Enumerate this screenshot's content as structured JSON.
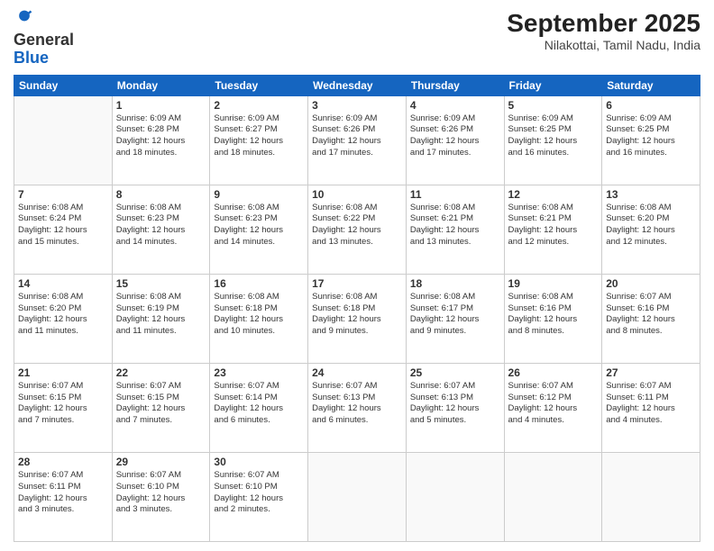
{
  "header": {
    "logo_general": "General",
    "logo_blue": "Blue",
    "month_year": "September 2025",
    "location": "Nilakottai, Tamil Nadu, India"
  },
  "weekdays": [
    "Sunday",
    "Monday",
    "Tuesday",
    "Wednesday",
    "Thursday",
    "Friday",
    "Saturday"
  ],
  "weeks": [
    [
      {
        "day": "",
        "info": ""
      },
      {
        "day": "1",
        "info": "Sunrise: 6:09 AM\nSunset: 6:28 PM\nDaylight: 12 hours\nand 18 minutes."
      },
      {
        "day": "2",
        "info": "Sunrise: 6:09 AM\nSunset: 6:27 PM\nDaylight: 12 hours\nand 18 minutes."
      },
      {
        "day": "3",
        "info": "Sunrise: 6:09 AM\nSunset: 6:26 PM\nDaylight: 12 hours\nand 17 minutes."
      },
      {
        "day": "4",
        "info": "Sunrise: 6:09 AM\nSunset: 6:26 PM\nDaylight: 12 hours\nand 17 minutes."
      },
      {
        "day": "5",
        "info": "Sunrise: 6:09 AM\nSunset: 6:25 PM\nDaylight: 12 hours\nand 16 minutes."
      },
      {
        "day": "6",
        "info": "Sunrise: 6:09 AM\nSunset: 6:25 PM\nDaylight: 12 hours\nand 16 minutes."
      }
    ],
    [
      {
        "day": "7",
        "info": "Sunrise: 6:08 AM\nSunset: 6:24 PM\nDaylight: 12 hours\nand 15 minutes."
      },
      {
        "day": "8",
        "info": "Sunrise: 6:08 AM\nSunset: 6:23 PM\nDaylight: 12 hours\nand 14 minutes."
      },
      {
        "day": "9",
        "info": "Sunrise: 6:08 AM\nSunset: 6:23 PM\nDaylight: 12 hours\nand 14 minutes."
      },
      {
        "day": "10",
        "info": "Sunrise: 6:08 AM\nSunset: 6:22 PM\nDaylight: 12 hours\nand 13 minutes."
      },
      {
        "day": "11",
        "info": "Sunrise: 6:08 AM\nSunset: 6:21 PM\nDaylight: 12 hours\nand 13 minutes."
      },
      {
        "day": "12",
        "info": "Sunrise: 6:08 AM\nSunset: 6:21 PM\nDaylight: 12 hours\nand 12 minutes."
      },
      {
        "day": "13",
        "info": "Sunrise: 6:08 AM\nSunset: 6:20 PM\nDaylight: 12 hours\nand 12 minutes."
      }
    ],
    [
      {
        "day": "14",
        "info": "Sunrise: 6:08 AM\nSunset: 6:20 PM\nDaylight: 12 hours\nand 11 minutes."
      },
      {
        "day": "15",
        "info": "Sunrise: 6:08 AM\nSunset: 6:19 PM\nDaylight: 12 hours\nand 11 minutes."
      },
      {
        "day": "16",
        "info": "Sunrise: 6:08 AM\nSunset: 6:18 PM\nDaylight: 12 hours\nand 10 minutes."
      },
      {
        "day": "17",
        "info": "Sunrise: 6:08 AM\nSunset: 6:18 PM\nDaylight: 12 hours\nand 9 minutes."
      },
      {
        "day": "18",
        "info": "Sunrise: 6:08 AM\nSunset: 6:17 PM\nDaylight: 12 hours\nand 9 minutes."
      },
      {
        "day": "19",
        "info": "Sunrise: 6:08 AM\nSunset: 6:16 PM\nDaylight: 12 hours\nand 8 minutes."
      },
      {
        "day": "20",
        "info": "Sunrise: 6:07 AM\nSunset: 6:16 PM\nDaylight: 12 hours\nand 8 minutes."
      }
    ],
    [
      {
        "day": "21",
        "info": "Sunrise: 6:07 AM\nSunset: 6:15 PM\nDaylight: 12 hours\nand 7 minutes."
      },
      {
        "day": "22",
        "info": "Sunrise: 6:07 AM\nSunset: 6:15 PM\nDaylight: 12 hours\nand 7 minutes."
      },
      {
        "day": "23",
        "info": "Sunrise: 6:07 AM\nSunset: 6:14 PM\nDaylight: 12 hours\nand 6 minutes."
      },
      {
        "day": "24",
        "info": "Sunrise: 6:07 AM\nSunset: 6:13 PM\nDaylight: 12 hours\nand 6 minutes."
      },
      {
        "day": "25",
        "info": "Sunrise: 6:07 AM\nSunset: 6:13 PM\nDaylight: 12 hours\nand 5 minutes."
      },
      {
        "day": "26",
        "info": "Sunrise: 6:07 AM\nSunset: 6:12 PM\nDaylight: 12 hours\nand 4 minutes."
      },
      {
        "day": "27",
        "info": "Sunrise: 6:07 AM\nSunset: 6:11 PM\nDaylight: 12 hours\nand 4 minutes."
      }
    ],
    [
      {
        "day": "28",
        "info": "Sunrise: 6:07 AM\nSunset: 6:11 PM\nDaylight: 12 hours\nand 3 minutes."
      },
      {
        "day": "29",
        "info": "Sunrise: 6:07 AM\nSunset: 6:10 PM\nDaylight: 12 hours\nand 3 minutes."
      },
      {
        "day": "30",
        "info": "Sunrise: 6:07 AM\nSunset: 6:10 PM\nDaylight: 12 hours\nand 2 minutes."
      },
      {
        "day": "",
        "info": ""
      },
      {
        "day": "",
        "info": ""
      },
      {
        "day": "",
        "info": ""
      },
      {
        "day": "",
        "info": ""
      }
    ]
  ]
}
